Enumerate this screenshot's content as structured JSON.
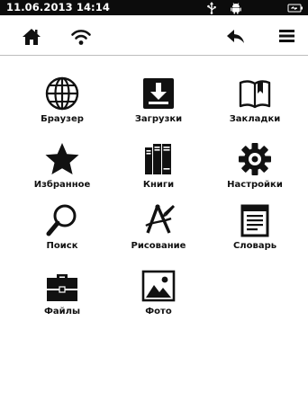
{
  "status_bar": {
    "datetime": "11.06.2013  14:14",
    "icons": [
      "usb-icon",
      "android-icon",
      "battery-icon"
    ]
  },
  "toolbar": {
    "left_icons": [
      "home-icon",
      "wifi-icon"
    ],
    "right_icons": [
      "back-icon",
      "menu-icon"
    ]
  },
  "apps": [
    {
      "label": "Браузер",
      "icon": "globe-icon"
    },
    {
      "label": "Загрузки",
      "icon": "download-icon"
    },
    {
      "label": "Закладки",
      "icon": "book-icon"
    },
    {
      "label": "Избранное",
      "icon": "star-icon"
    },
    {
      "label": "Книги",
      "icon": "books-icon"
    },
    {
      "label": "Настройки",
      "icon": "gear-icon"
    },
    {
      "label": "Поиск",
      "icon": "magnifier-icon"
    },
    {
      "label": "Рисование",
      "icon": "drawing-icon"
    },
    {
      "label": "Словарь",
      "icon": "dictionary-icon"
    },
    {
      "label": "Файлы",
      "icon": "briefcase-icon"
    },
    {
      "label": "Фото",
      "icon": "photo-icon"
    }
  ]
}
